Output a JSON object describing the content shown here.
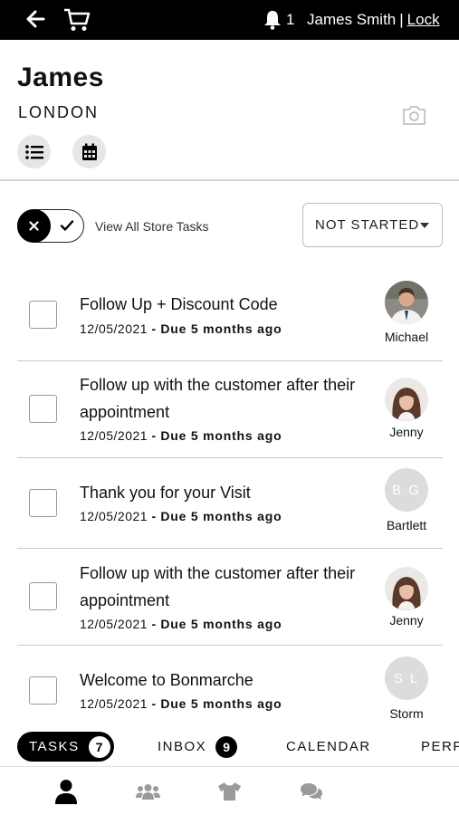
{
  "header": {
    "notification_count": "1",
    "user_name": "James Smith",
    "separator": "|",
    "lock_label": "Lock"
  },
  "profile": {
    "name": "James",
    "location": "LONDON"
  },
  "filters": {
    "view_all_label": "View All Store Tasks",
    "status_selected": "NOT STARTED"
  },
  "tasks": [
    {
      "title": "Follow Up + Discount Code",
      "date": "12/05/2021",
      "separator": "-",
      "due": "Due 5 months ago",
      "assignee": "Michael",
      "avatar": "photo-icon"
    },
    {
      "title": "Follow up with the customer after their appointment",
      "date": "12/05/2021",
      "separator": "-",
      "due": "Due 5 months ago",
      "assignee": "Jenny",
      "avatar": "photo-icon"
    },
    {
      "title": "Thank you for your Visit",
      "date": "12/05/2021",
      "separator": "-",
      "due": "Due 5 months ago",
      "assignee": "Bartlett",
      "initials": "B G"
    },
    {
      "title": "Follow up with the customer after their appointment",
      "date": "12/05/2021",
      "separator": "-",
      "due": "Due 5 months ago",
      "assignee": "Jenny",
      "avatar": "photo-icon"
    },
    {
      "title": "Welcome to Bonmarche",
      "date": "12/05/2021",
      "separator": "-",
      "due": "Due 5 months ago",
      "assignee": "Storm",
      "initials": "S L"
    }
  ],
  "tabs": [
    {
      "label": "TASKS",
      "badge": "7"
    },
    {
      "label": "INBOX",
      "badge": "9"
    },
    {
      "label": "CALENDAR"
    },
    {
      "label": "PERFO"
    }
  ],
  "bottom_nav": [
    {
      "icon": "person-icon"
    },
    {
      "icon": "group-icon"
    },
    {
      "icon": "tshirt-icon"
    },
    {
      "icon": "chat-icon"
    }
  ],
  "colors": {
    "header_bg": "#000000",
    "avatar_placeholder": "#dcdcdc",
    "inactive_icon": "#9a9a9a"
  }
}
